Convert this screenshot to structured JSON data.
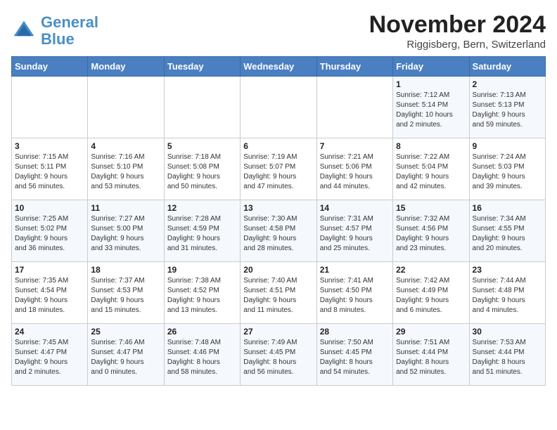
{
  "header": {
    "logo_line1": "General",
    "logo_line2": "Blue",
    "month": "November 2024",
    "location": "Riggisberg, Bern, Switzerland"
  },
  "days_of_week": [
    "Sunday",
    "Monday",
    "Tuesday",
    "Wednesday",
    "Thursday",
    "Friday",
    "Saturday"
  ],
  "weeks": [
    [
      {
        "day": "",
        "info": ""
      },
      {
        "day": "",
        "info": ""
      },
      {
        "day": "",
        "info": ""
      },
      {
        "day": "",
        "info": ""
      },
      {
        "day": "",
        "info": ""
      },
      {
        "day": "1",
        "info": "Sunrise: 7:12 AM\nSunset: 5:14 PM\nDaylight: 10 hours\nand 2 minutes."
      },
      {
        "day": "2",
        "info": "Sunrise: 7:13 AM\nSunset: 5:13 PM\nDaylight: 9 hours\nand 59 minutes."
      }
    ],
    [
      {
        "day": "3",
        "info": "Sunrise: 7:15 AM\nSunset: 5:11 PM\nDaylight: 9 hours\nand 56 minutes."
      },
      {
        "day": "4",
        "info": "Sunrise: 7:16 AM\nSunset: 5:10 PM\nDaylight: 9 hours\nand 53 minutes."
      },
      {
        "day": "5",
        "info": "Sunrise: 7:18 AM\nSunset: 5:08 PM\nDaylight: 9 hours\nand 50 minutes."
      },
      {
        "day": "6",
        "info": "Sunrise: 7:19 AM\nSunset: 5:07 PM\nDaylight: 9 hours\nand 47 minutes."
      },
      {
        "day": "7",
        "info": "Sunrise: 7:21 AM\nSunset: 5:06 PM\nDaylight: 9 hours\nand 44 minutes."
      },
      {
        "day": "8",
        "info": "Sunrise: 7:22 AM\nSunset: 5:04 PM\nDaylight: 9 hours\nand 42 minutes."
      },
      {
        "day": "9",
        "info": "Sunrise: 7:24 AM\nSunset: 5:03 PM\nDaylight: 9 hours\nand 39 minutes."
      }
    ],
    [
      {
        "day": "10",
        "info": "Sunrise: 7:25 AM\nSunset: 5:02 PM\nDaylight: 9 hours\nand 36 minutes."
      },
      {
        "day": "11",
        "info": "Sunrise: 7:27 AM\nSunset: 5:00 PM\nDaylight: 9 hours\nand 33 minutes."
      },
      {
        "day": "12",
        "info": "Sunrise: 7:28 AM\nSunset: 4:59 PM\nDaylight: 9 hours\nand 31 minutes."
      },
      {
        "day": "13",
        "info": "Sunrise: 7:30 AM\nSunset: 4:58 PM\nDaylight: 9 hours\nand 28 minutes."
      },
      {
        "day": "14",
        "info": "Sunrise: 7:31 AM\nSunset: 4:57 PM\nDaylight: 9 hours\nand 25 minutes."
      },
      {
        "day": "15",
        "info": "Sunrise: 7:32 AM\nSunset: 4:56 PM\nDaylight: 9 hours\nand 23 minutes."
      },
      {
        "day": "16",
        "info": "Sunrise: 7:34 AM\nSunset: 4:55 PM\nDaylight: 9 hours\nand 20 minutes."
      }
    ],
    [
      {
        "day": "17",
        "info": "Sunrise: 7:35 AM\nSunset: 4:54 PM\nDaylight: 9 hours\nand 18 minutes."
      },
      {
        "day": "18",
        "info": "Sunrise: 7:37 AM\nSunset: 4:53 PM\nDaylight: 9 hours\nand 15 minutes."
      },
      {
        "day": "19",
        "info": "Sunrise: 7:38 AM\nSunset: 4:52 PM\nDaylight: 9 hours\nand 13 minutes."
      },
      {
        "day": "20",
        "info": "Sunrise: 7:40 AM\nSunset: 4:51 PM\nDaylight: 9 hours\nand 11 minutes."
      },
      {
        "day": "21",
        "info": "Sunrise: 7:41 AM\nSunset: 4:50 PM\nDaylight: 9 hours\nand 8 minutes."
      },
      {
        "day": "22",
        "info": "Sunrise: 7:42 AM\nSunset: 4:49 PM\nDaylight: 9 hours\nand 6 minutes."
      },
      {
        "day": "23",
        "info": "Sunrise: 7:44 AM\nSunset: 4:48 PM\nDaylight: 9 hours\nand 4 minutes."
      }
    ],
    [
      {
        "day": "24",
        "info": "Sunrise: 7:45 AM\nSunset: 4:47 PM\nDaylight: 9 hours\nand 2 minutes."
      },
      {
        "day": "25",
        "info": "Sunrise: 7:46 AM\nSunset: 4:47 PM\nDaylight: 9 hours\nand 0 minutes."
      },
      {
        "day": "26",
        "info": "Sunrise: 7:48 AM\nSunset: 4:46 PM\nDaylight: 8 hours\nand 58 minutes."
      },
      {
        "day": "27",
        "info": "Sunrise: 7:49 AM\nSunset: 4:45 PM\nDaylight: 8 hours\nand 56 minutes."
      },
      {
        "day": "28",
        "info": "Sunrise: 7:50 AM\nSunset: 4:45 PM\nDaylight: 8 hours\nand 54 minutes."
      },
      {
        "day": "29",
        "info": "Sunrise: 7:51 AM\nSunset: 4:44 PM\nDaylight: 8 hours\nand 52 minutes."
      },
      {
        "day": "30",
        "info": "Sunrise: 7:53 AM\nSunset: 4:44 PM\nDaylight: 8 hours\nand 51 minutes."
      }
    ]
  ]
}
